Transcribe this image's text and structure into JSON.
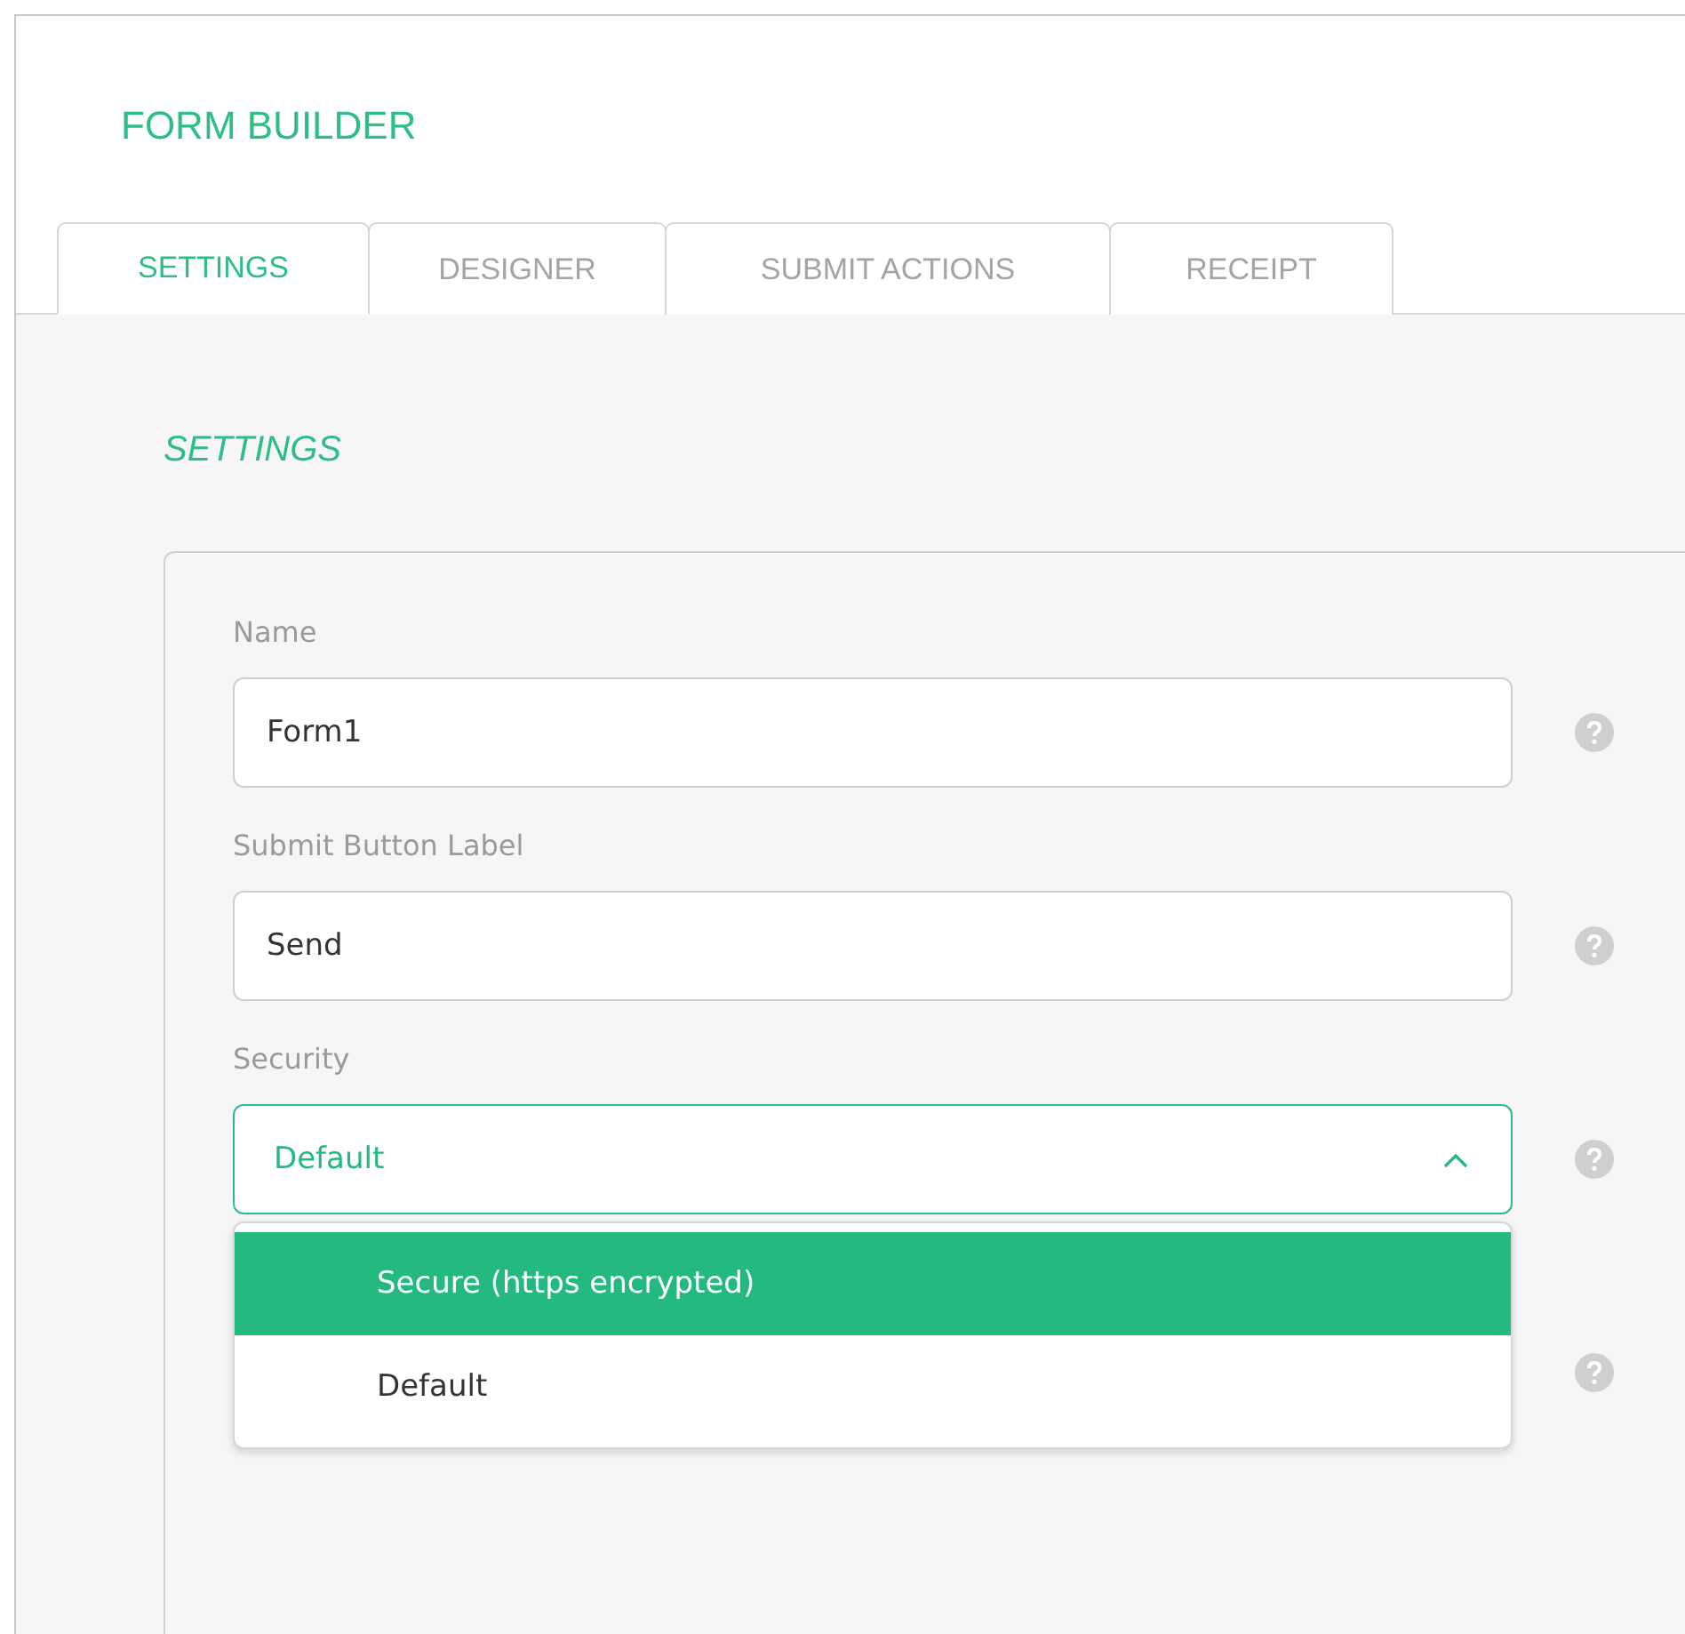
{
  "title": "FORM BUILDER",
  "tabs": [
    {
      "label": "SETTINGS",
      "selected": true
    },
    {
      "label": "DESIGNER",
      "selected": false
    },
    {
      "label": "SUBMIT ACTIONS",
      "selected": false
    },
    {
      "label": "RECEIPT",
      "selected": false
    }
  ],
  "section_title": "SETTINGS",
  "fields": [
    {
      "kind": "text",
      "label": "Name",
      "value": "Form1"
    },
    {
      "kind": "text",
      "label": "Submit Button Label",
      "value": "Send"
    },
    {
      "kind": "select",
      "label": "Security",
      "value": "Default",
      "expanded": true,
      "options": [
        {
          "label": "Secure (https encrypted)",
          "highlighted": true
        },
        {
          "label": "Default",
          "highlighted": false
        }
      ]
    },
    {
      "kind": "covered"
    }
  ]
}
